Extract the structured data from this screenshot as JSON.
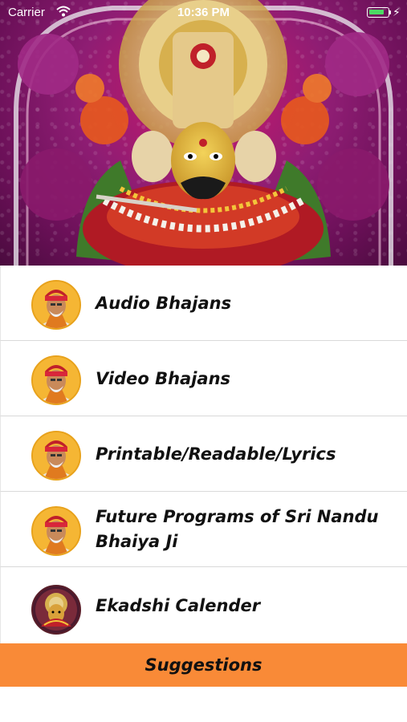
{
  "status_bar": {
    "carrier": "Carrier",
    "time": "10:36 PM",
    "battery_level": 0.75
  },
  "hero": {
    "icon": "shrine-deity-image",
    "colors": {
      "flowers": "#8e1d73",
      "accent": "#e8591d",
      "gold": "#d7b04e"
    }
  },
  "menu": {
    "items": [
      {
        "label": "Audio Bhajans",
        "icon": "guru-portrait-icon"
      },
      {
        "label": "Video Bhajans",
        "icon": "guru-portrait-icon"
      },
      {
        "label": "Printable/Readable/Lyrics",
        "icon": "guru-portrait-icon"
      },
      {
        "label": "Future Programs of Sri Nandu Bhaiya Ji",
        "icon": "guru-portrait-icon"
      },
      {
        "label": "Ekadshi Calender",
        "icon": "deity-calendar-icon"
      }
    ]
  },
  "suggestions": {
    "label": "Suggestions",
    "color": "#f98a37"
  }
}
